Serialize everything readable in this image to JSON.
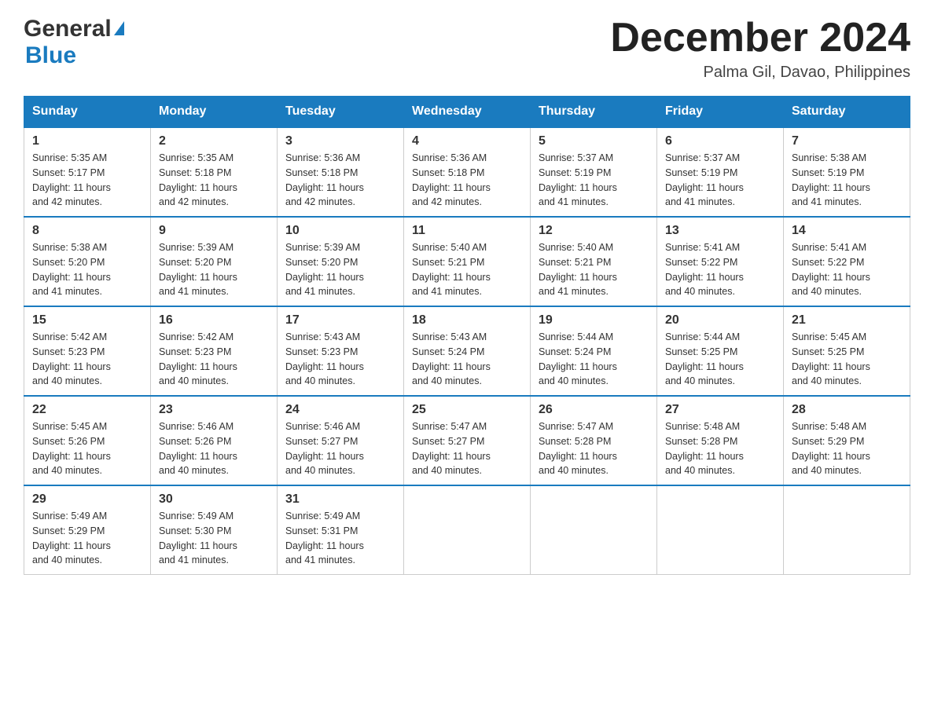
{
  "header": {
    "logo_general": "General",
    "logo_blue": "Blue",
    "month_year": "December 2024",
    "location": "Palma Gil, Davao, Philippines"
  },
  "weekdays": [
    "Sunday",
    "Monday",
    "Tuesday",
    "Wednesday",
    "Thursday",
    "Friday",
    "Saturday"
  ],
  "weeks": [
    [
      {
        "day": "1",
        "sunrise": "5:35 AM",
        "sunset": "5:17 PM",
        "daylight": "11 hours and 42 minutes."
      },
      {
        "day": "2",
        "sunrise": "5:35 AM",
        "sunset": "5:18 PM",
        "daylight": "11 hours and 42 minutes."
      },
      {
        "day": "3",
        "sunrise": "5:36 AM",
        "sunset": "5:18 PM",
        "daylight": "11 hours and 42 minutes."
      },
      {
        "day": "4",
        "sunrise": "5:36 AM",
        "sunset": "5:18 PM",
        "daylight": "11 hours and 42 minutes."
      },
      {
        "day": "5",
        "sunrise": "5:37 AM",
        "sunset": "5:19 PM",
        "daylight": "11 hours and 41 minutes."
      },
      {
        "day": "6",
        "sunrise": "5:37 AM",
        "sunset": "5:19 PM",
        "daylight": "11 hours and 41 minutes."
      },
      {
        "day": "7",
        "sunrise": "5:38 AM",
        "sunset": "5:19 PM",
        "daylight": "11 hours and 41 minutes."
      }
    ],
    [
      {
        "day": "8",
        "sunrise": "5:38 AM",
        "sunset": "5:20 PM",
        "daylight": "11 hours and 41 minutes."
      },
      {
        "day": "9",
        "sunrise": "5:39 AM",
        "sunset": "5:20 PM",
        "daylight": "11 hours and 41 minutes."
      },
      {
        "day": "10",
        "sunrise": "5:39 AM",
        "sunset": "5:20 PM",
        "daylight": "11 hours and 41 minutes."
      },
      {
        "day": "11",
        "sunrise": "5:40 AM",
        "sunset": "5:21 PM",
        "daylight": "11 hours and 41 minutes."
      },
      {
        "day": "12",
        "sunrise": "5:40 AM",
        "sunset": "5:21 PM",
        "daylight": "11 hours and 41 minutes."
      },
      {
        "day": "13",
        "sunrise": "5:41 AM",
        "sunset": "5:22 PM",
        "daylight": "11 hours and 40 minutes."
      },
      {
        "day": "14",
        "sunrise": "5:41 AM",
        "sunset": "5:22 PM",
        "daylight": "11 hours and 40 minutes."
      }
    ],
    [
      {
        "day": "15",
        "sunrise": "5:42 AM",
        "sunset": "5:23 PM",
        "daylight": "11 hours and 40 minutes."
      },
      {
        "day": "16",
        "sunrise": "5:42 AM",
        "sunset": "5:23 PM",
        "daylight": "11 hours and 40 minutes."
      },
      {
        "day": "17",
        "sunrise": "5:43 AM",
        "sunset": "5:23 PM",
        "daylight": "11 hours and 40 minutes."
      },
      {
        "day": "18",
        "sunrise": "5:43 AM",
        "sunset": "5:24 PM",
        "daylight": "11 hours and 40 minutes."
      },
      {
        "day": "19",
        "sunrise": "5:44 AM",
        "sunset": "5:24 PM",
        "daylight": "11 hours and 40 minutes."
      },
      {
        "day": "20",
        "sunrise": "5:44 AM",
        "sunset": "5:25 PM",
        "daylight": "11 hours and 40 minutes."
      },
      {
        "day": "21",
        "sunrise": "5:45 AM",
        "sunset": "5:25 PM",
        "daylight": "11 hours and 40 minutes."
      }
    ],
    [
      {
        "day": "22",
        "sunrise": "5:45 AM",
        "sunset": "5:26 PM",
        "daylight": "11 hours and 40 minutes."
      },
      {
        "day": "23",
        "sunrise": "5:46 AM",
        "sunset": "5:26 PM",
        "daylight": "11 hours and 40 minutes."
      },
      {
        "day": "24",
        "sunrise": "5:46 AM",
        "sunset": "5:27 PM",
        "daylight": "11 hours and 40 minutes."
      },
      {
        "day": "25",
        "sunrise": "5:47 AM",
        "sunset": "5:27 PM",
        "daylight": "11 hours and 40 minutes."
      },
      {
        "day": "26",
        "sunrise": "5:47 AM",
        "sunset": "5:28 PM",
        "daylight": "11 hours and 40 minutes."
      },
      {
        "day": "27",
        "sunrise": "5:48 AM",
        "sunset": "5:28 PM",
        "daylight": "11 hours and 40 minutes."
      },
      {
        "day": "28",
        "sunrise": "5:48 AM",
        "sunset": "5:29 PM",
        "daylight": "11 hours and 40 minutes."
      }
    ],
    [
      {
        "day": "29",
        "sunrise": "5:49 AM",
        "sunset": "5:29 PM",
        "daylight": "11 hours and 40 minutes."
      },
      {
        "day": "30",
        "sunrise": "5:49 AM",
        "sunset": "5:30 PM",
        "daylight": "11 hours and 41 minutes."
      },
      {
        "day": "31",
        "sunrise": "5:49 AM",
        "sunset": "5:31 PM",
        "daylight": "11 hours and 41 minutes."
      },
      null,
      null,
      null,
      null
    ]
  ],
  "labels": {
    "sunrise": "Sunrise:",
    "sunset": "Sunset:",
    "daylight": "Daylight:"
  }
}
